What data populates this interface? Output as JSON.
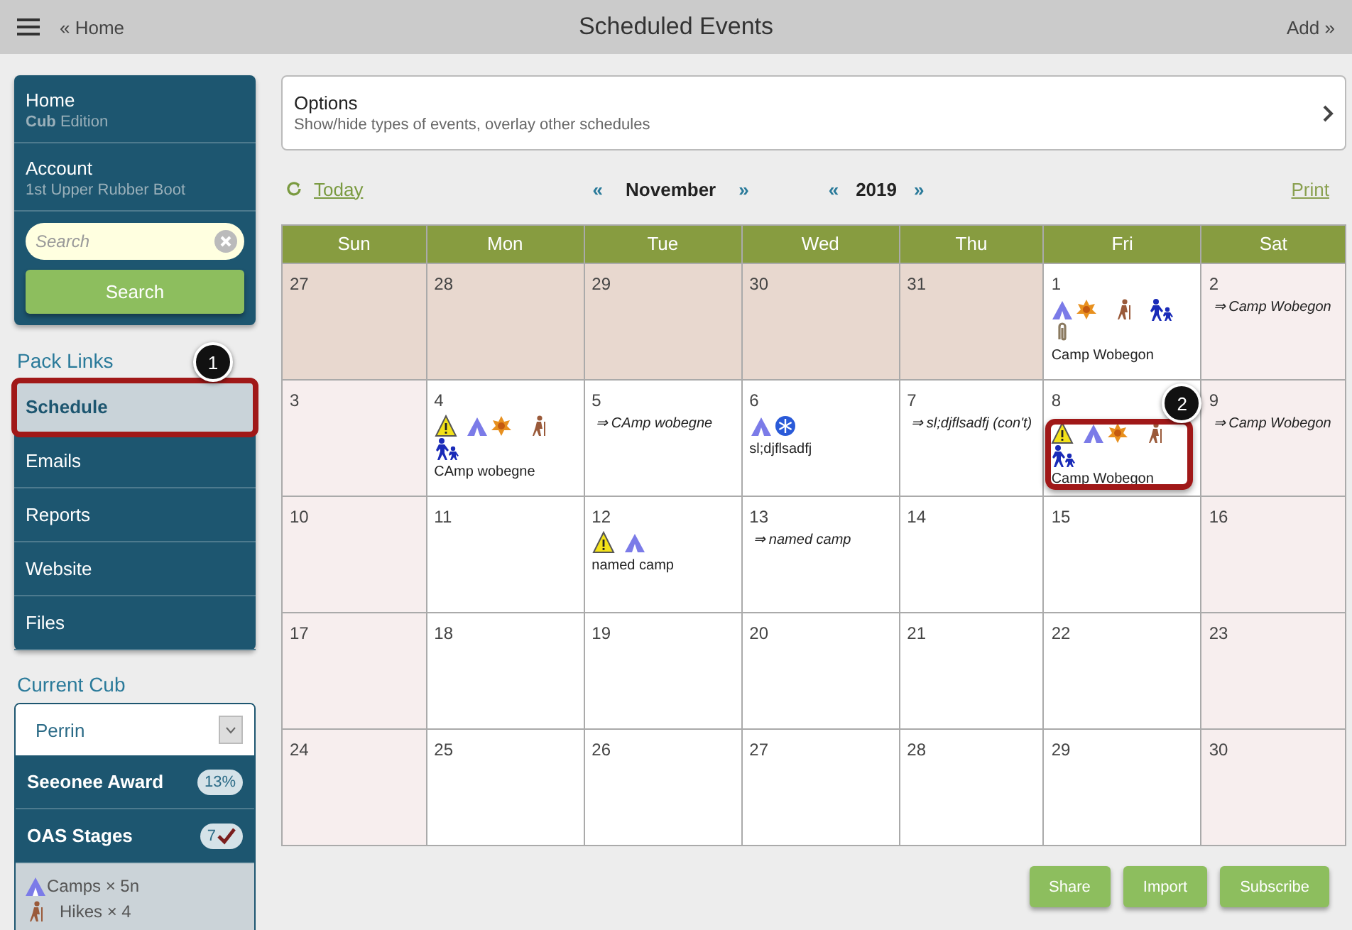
{
  "topbar": {
    "home_link": "« Home",
    "title": "Scheduled Events",
    "add_link": "Add »"
  },
  "sidebar": {
    "account_panel": [
      {
        "title": "Home",
        "subtitle": "**Cub** Edition"
      },
      {
        "title": "Account",
        "subtitle": "1st Upper Rubber Boot"
      }
    ],
    "search": {
      "placeholder": "Search",
      "button": "Search"
    },
    "pack_links": {
      "heading": "Pack Links",
      "items": [
        {
          "label": "Schedule",
          "selected": true,
          "callout": "1"
        },
        {
          "label": "Emails",
          "selected": false
        },
        {
          "label": "Reports",
          "selected": false
        },
        {
          "label": "Website",
          "selected": false
        },
        {
          "label": "Files",
          "selected": false
        }
      ]
    },
    "current_cub": {
      "heading": "Current Cub",
      "select_value": "Perrin",
      "stats": [
        {
          "label": "Seeonee Award",
          "badge": "13%",
          "kind": "percent"
        },
        {
          "label": "OAS Stages",
          "badge": "7",
          "kind": "check"
        }
      ],
      "summary": [
        {
          "kind": "tent",
          "text": "Camps × 5n"
        },
        {
          "kind": "hiker",
          "text": "Hikes × 4"
        }
      ]
    }
  },
  "options": {
    "title": "Options",
    "subtitle": "Show/hide types of events, overlay other schedules"
  },
  "calendar_nav": {
    "today": "Today",
    "month": "November",
    "year": "2019",
    "prev": "«",
    "next": "»",
    "print": "Print"
  },
  "calendar": {
    "weekdays": [
      "Sun",
      "Mon",
      "Tue",
      "Wed",
      "Thu",
      "Fri",
      "Sat"
    ],
    "weeks": [
      [
        {
          "day": "27",
          "kind": "other"
        },
        {
          "day": "28",
          "kind": "other"
        },
        {
          "day": "29",
          "kind": "other"
        },
        {
          "day": "30",
          "kind": "other"
        },
        {
          "day": "31",
          "kind": "other"
        },
        {
          "day": "1",
          "kind": "day",
          "icons": [
            {
              "kind": "tent"
            },
            {
              "kind": "leaf"
            },
            {
              "kind": "hiker"
            },
            {
              "kind": "family"
            },
            {
              "kind": "paperclip"
            }
          ],
          "event": {
            "text": "Camp Wobegon",
            "continued": false
          }
        },
        {
          "day": "2",
          "kind": "weekend",
          "event": {
            "text": "⇒ Camp Wobegon",
            "continued": true
          }
        }
      ],
      [
        {
          "day": "3",
          "kind": "weekend"
        },
        {
          "day": "4",
          "kind": "day",
          "icons": [
            {
              "kind": "warning"
            },
            {
              "kind": "tent"
            },
            {
              "kind": "leaf"
            },
            {
              "kind": "hiker"
            },
            {
              "kind": "family"
            }
          ],
          "event": {
            "text": "CAmp wobegne",
            "continued": false
          }
        },
        {
          "day": "5",
          "kind": "day",
          "event": {
            "text": "⇒ CAmp wobegne",
            "continued": true
          }
        },
        {
          "day": "6",
          "kind": "day",
          "icons": [
            {
              "kind": "tent"
            },
            {
              "kind": "snowflake"
            }
          ],
          "event": {
            "text": "sl;djflsadfj",
            "continued": false
          }
        },
        {
          "day": "7",
          "kind": "day",
          "event": {
            "text": "⇒ sl;djflsadfj (con't)",
            "continued": true
          }
        },
        {
          "day": "8",
          "kind": "day",
          "icons": [
            {
              "kind": "warning"
            },
            {
              "kind": "tent"
            },
            {
              "kind": "leaf"
            },
            {
              "kind": "hiker"
            },
            {
              "kind": "family"
            }
          ],
          "event": {
            "text": "Camp Wobegon",
            "continued": false
          },
          "callout": "2"
        },
        {
          "day": "9",
          "kind": "weekend",
          "event": {
            "text": "⇒ Camp Wobegon",
            "continued": true
          }
        }
      ],
      [
        {
          "day": "10",
          "kind": "weekend"
        },
        {
          "day": "11",
          "kind": "day"
        },
        {
          "day": "12",
          "kind": "day",
          "icons": [
            {
              "kind": "warning"
            },
            {
              "kind": "tent"
            }
          ],
          "event": {
            "text": "named camp",
            "continued": false
          }
        },
        {
          "day": "13",
          "kind": "day",
          "event": {
            "text": "⇒ named camp",
            "continued": true
          }
        },
        {
          "day": "14",
          "kind": "day"
        },
        {
          "day": "15",
          "kind": "day"
        },
        {
          "day": "16",
          "kind": "weekend"
        }
      ],
      [
        {
          "day": "17",
          "kind": "weekend"
        },
        {
          "day": "18",
          "kind": "day"
        },
        {
          "day": "19",
          "kind": "day"
        },
        {
          "day": "20",
          "kind": "day"
        },
        {
          "day": "21",
          "kind": "day"
        },
        {
          "day": "22",
          "kind": "day"
        },
        {
          "day": "23",
          "kind": "weekend"
        }
      ],
      [
        {
          "day": "24",
          "kind": "weekend"
        },
        {
          "day": "25",
          "kind": "day"
        },
        {
          "day": "26",
          "kind": "day"
        },
        {
          "day": "27",
          "kind": "day"
        },
        {
          "day": "28",
          "kind": "day"
        },
        {
          "day": "29",
          "kind": "day"
        },
        {
          "day": "30",
          "kind": "weekend"
        }
      ]
    ]
  },
  "buttons": [
    "Share",
    "Import",
    "Subscribe"
  ]
}
